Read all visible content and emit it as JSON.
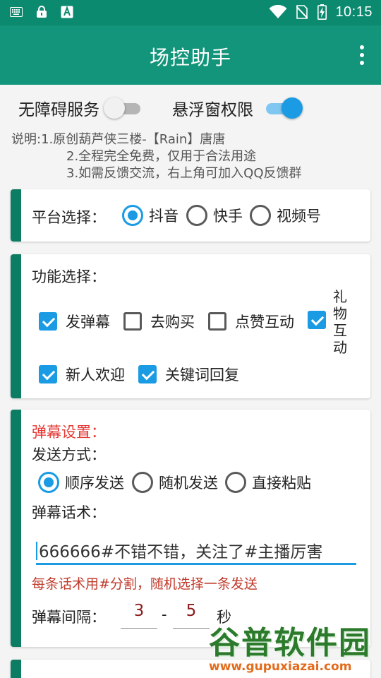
{
  "status_bar": {
    "time": "10:15",
    "icons": [
      "keyboard-icon",
      "lock-icon",
      "a-icon",
      "wifi-icon",
      "no-sim-icon",
      "battery-charging-icon"
    ]
  },
  "app_bar": {
    "title": "场控助手"
  },
  "permissions": {
    "accessibility_label": "无障碍服务",
    "accessibility_on": false,
    "overlay_label": "悬浮窗权限",
    "overlay_on": true
  },
  "description": {
    "line1": "说明:1.原创葫芦侠三楼-【Rain】唐唐",
    "line2": "2.全程完全免费，仅用于合法用途",
    "line3": "3.如需反馈交流，右上角可加入QQ反馈群"
  },
  "platform": {
    "label": "平台选择：",
    "options": [
      "抖音",
      "快手",
      "视频号"
    ],
    "selected": "抖音"
  },
  "functions": {
    "label": "功能选择：",
    "items": [
      {
        "label": "发弹幕",
        "checked": true
      },
      {
        "label": "去购买",
        "checked": false
      },
      {
        "label": "点赞互动",
        "checked": false
      },
      {
        "label": "礼物互动",
        "checked": true
      },
      {
        "label": "新人欢迎",
        "checked": true
      },
      {
        "label": "关键词回复",
        "checked": true
      }
    ]
  },
  "danmu": {
    "section_title": "弹幕设置：",
    "send_mode_label": "发送方式：",
    "send_modes": [
      "顺序发送",
      "随机发送",
      "直接粘贴"
    ],
    "send_mode_selected": "顺序发送",
    "script_label": "弹幕话术：",
    "script_value": "666666#不错不错，关注了#主播厉害",
    "hint": "每条话术用#分割，随机选择一条发送",
    "interval_label": "弹幕间隔：",
    "interval_min": "3",
    "interval_sep": "-",
    "interval_max": "5",
    "interval_unit": "秒"
  },
  "watermark": {
    "title": "谷普软件园",
    "url": "www.gupuxiazai.com"
  },
  "colors": {
    "primary": "#12957a",
    "status_bar": "#0c8a70",
    "accent": "#1a9be4",
    "card_bar": "#0c7d62",
    "section_red": "#e53935"
  }
}
